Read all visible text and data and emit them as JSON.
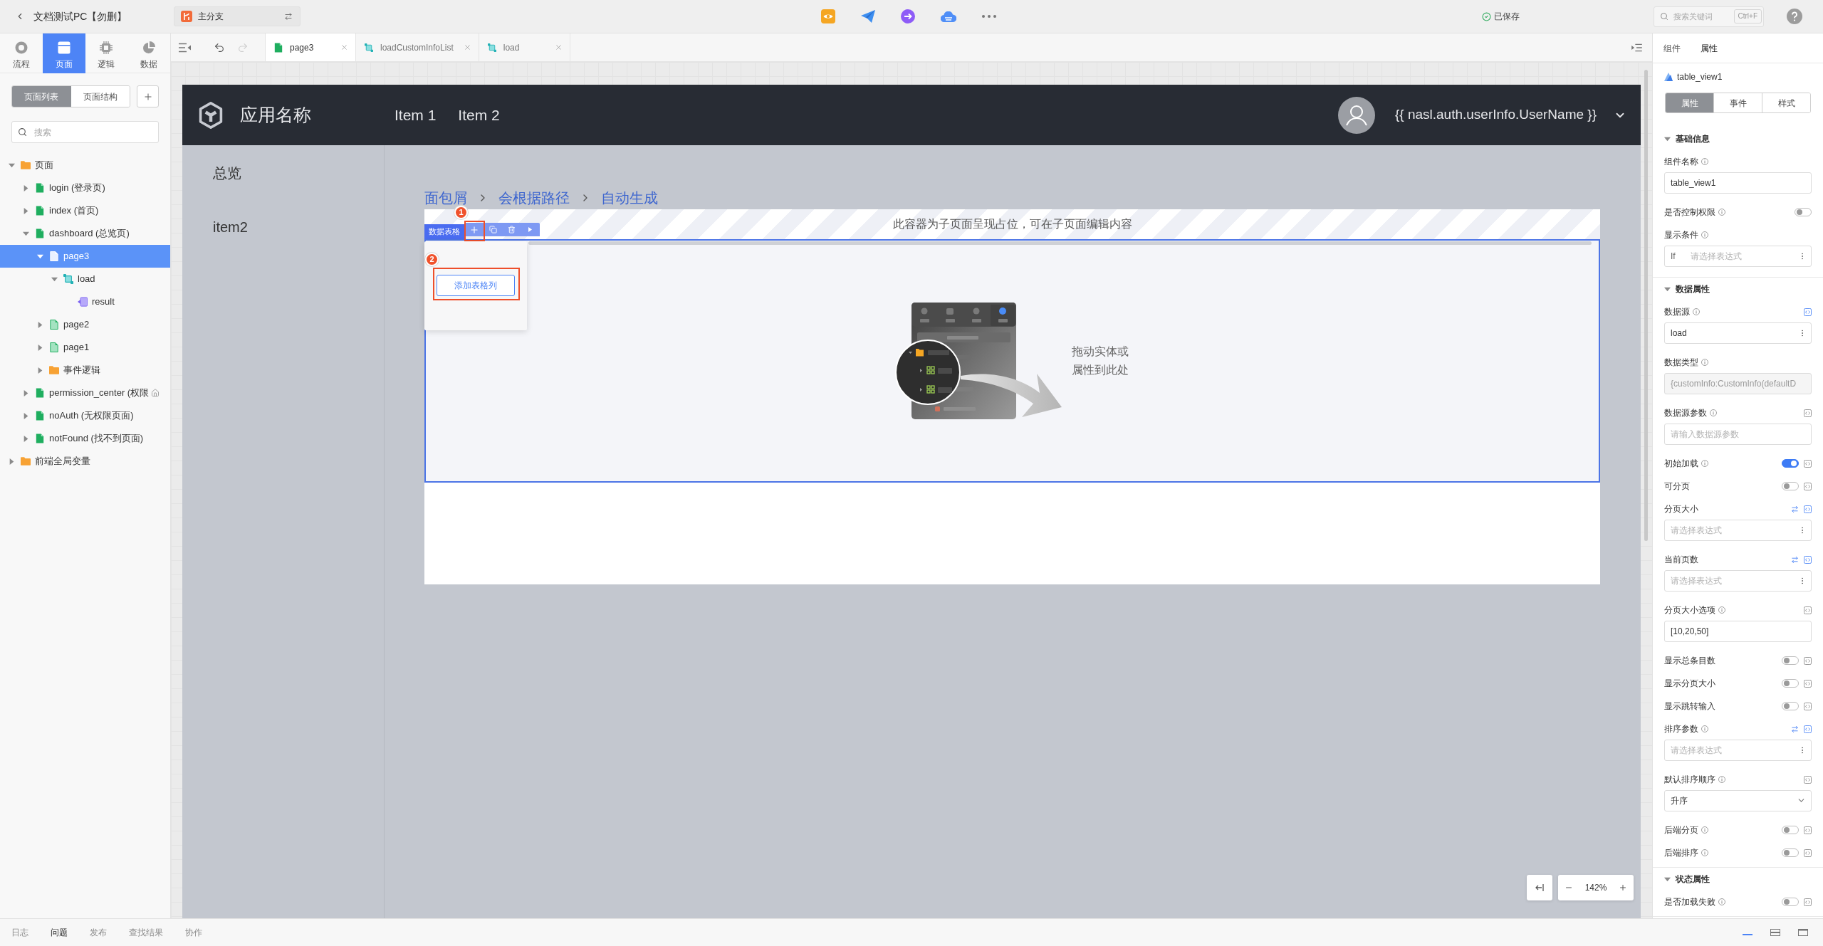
{
  "topbar": {
    "title": "文档测试PC【勿删】",
    "branch": "主分支",
    "save_status": "已保存",
    "search": {
      "placeholder": "搜索关键词",
      "shortcut": "Ctrl+F"
    }
  },
  "left_tabs": [
    {
      "label": "流程",
      "kind": "flow",
      "selected": false
    },
    {
      "label": "页面",
      "kind": "page",
      "selected": true
    },
    {
      "label": "逻辑",
      "kind": "logic",
      "selected": false
    },
    {
      "label": "数据",
      "kind": "data",
      "selected": false
    }
  ],
  "view_switch": [
    {
      "label": "页面列表",
      "selected": true
    },
    {
      "label": "页面结构",
      "selected": false
    }
  ],
  "tree_search": {
    "placeholder": "搜索"
  },
  "tree": [
    {
      "label": "页面",
      "kind": "folder",
      "expanded": true,
      "selected": false,
      "children": [
        {
          "label": "login (登录页)",
          "kind": "page",
          "expanded": false,
          "selected": false,
          "home": false
        },
        {
          "label": "index (首页)",
          "kind": "page",
          "expanded": false,
          "selected": false,
          "home": false
        },
        {
          "label": "dashboard (总览页)",
          "kind": "page",
          "expanded": true,
          "selected": false,
          "home": false,
          "children": [
            {
              "label": "page3",
              "kind": "subpage",
              "expanded": true,
              "selected": true,
              "children": [
                {
                  "label": "load",
                  "kind": "logic",
                  "expanded": true,
                  "selected": false,
                  "children": [
                    {
                      "label": "result",
                      "kind": "variable",
                      "selected": false
                    }
                  ]
                }
              ]
            },
            {
              "label": "page2",
              "kind": "subpage",
              "expanded": false,
              "selected": false
            },
            {
              "label": "page1",
              "kind": "subpage",
              "expanded": false,
              "selected": false
            },
            {
              "label": "事件逻辑",
              "kind": "folder",
              "expanded": false,
              "selected": false
            }
          ]
        },
        {
          "label": "permission_center (权限",
          "kind": "page",
          "expanded": false,
          "selected": false,
          "home": true
        },
        {
          "label": "noAuth (无权限页面)",
          "kind": "page",
          "expanded": false,
          "selected": false,
          "home": false
        },
        {
          "label": "notFound (找不到页面)",
          "kind": "page",
          "expanded": false,
          "selected": false,
          "home": false
        }
      ]
    },
    {
      "label": "前端全局变量",
      "kind": "folder",
      "expanded": false,
      "selected": false
    }
  ],
  "editor": {
    "history": [
      {
        "kind": "undo",
        "disabled": false
      },
      {
        "kind": "redo",
        "disabled": true
      }
    ],
    "tabs": [
      {
        "label": "page3",
        "kind": "page",
        "selected": true
      },
      {
        "label": "loadCustomInfoList",
        "kind": "logic",
        "selected": false
      },
      {
        "label": "load",
        "kind": "logic",
        "selected": false
      }
    ]
  },
  "preview": {
    "app_name": "应用名称",
    "nav": [
      "Item 1",
      "Item 2"
    ],
    "user": "{{ nasl.auth.userInfo.UserName }}",
    "sidebar": [
      "总览",
      "item2"
    ],
    "breadcrumb": [
      "面包屑",
      "会根据路径",
      "自动生成"
    ],
    "placeholder_message": "此容器为子页面呈现占位，可在子页面编辑内容",
    "table": {
      "label": "数据表格",
      "add_column_button": "添加表格列",
      "empty_hint": "拖动实体或属性到此处"
    },
    "steps": [
      "1",
      "2"
    ]
  },
  "zoom": {
    "value": "142%"
  },
  "properties": {
    "tabs": [
      {
        "label": "组件",
        "selected": false
      },
      {
        "label": "属性",
        "selected": true
      }
    ],
    "component_name": "table_view1",
    "sub_tabs": [
      {
        "label": "属性",
        "selected": true
      },
      {
        "label": "事件",
        "selected": false
      },
      {
        "label": "样式",
        "selected": false
      }
    ],
    "sections": [
      {
        "title": "基础信息",
        "expanded": true,
        "fields": [
          {
            "label": "组件名称",
            "info": true,
            "kind": "text",
            "value": "table_view1"
          },
          {
            "label": "是否控制权限",
            "info": true,
            "kind": "switch",
            "on": false
          },
          {
            "label": "显示条件",
            "info": true,
            "kind": "expression",
            "prefix": "If",
            "placeholder": "请选择表达式"
          }
        ]
      },
      {
        "title": "数据属性",
        "expanded": true,
        "fields": [
          {
            "label": "数据源",
            "info": true,
            "kind": "menu_select",
            "value": "load",
            "swap": false,
            "bound": true
          },
          {
            "label": "数据类型",
            "info": true,
            "kind": "readonly",
            "value": "{customInfo:CustomInfo(defaultD",
            "swap": false
          },
          {
            "label": "数据源参数",
            "info": true,
            "kind": "text",
            "placeholder": "请输入数据源参数",
            "swap": false,
            "bound": false
          },
          {
            "label": "初始加载",
            "info": true,
            "kind": "switch",
            "on": true,
            "swap": false,
            "bound": false
          },
          {
            "label": "可分页",
            "info": false,
            "kind": "switch",
            "on": false,
            "swap": false,
            "bound": false
          },
          {
            "label": "分页大小",
            "info": false,
            "kind": "expression",
            "placeholder": "请选择表达式",
            "swap": true,
            "bound": true
          },
          {
            "label": "当前页数",
            "info": false,
            "kind": "expression",
            "placeholder": "请选择表达式",
            "swap": true,
            "bound": true
          },
          {
            "label": "分页大小选项",
            "info": true,
            "kind": "text",
            "value": "[10,20,50]",
            "swap": false,
            "bound": false
          },
          {
            "label": "显示总条目数",
            "info": false,
            "kind": "switch",
            "on": false,
            "swap": false,
            "bound": false
          },
          {
            "label": "显示分页大小",
            "info": false,
            "kind": "switch",
            "on": false,
            "swap": false,
            "bound": false
          },
          {
            "label": "显示跳转输入",
            "info": false,
            "kind": "switch",
            "on": false,
            "swap": false,
            "bound": false
          },
          {
            "label": "排序参数",
            "info": true,
            "kind": "expression",
            "placeholder": "请选择表达式",
            "swap": true,
            "bound": true
          },
          {
            "label": "默认排序顺序",
            "info": true,
            "kind": "dropdown",
            "value": "升序",
            "swap": false,
            "bound": false
          },
          {
            "label": "后端分页",
            "info": true,
            "kind": "switch",
            "on": false,
            "swap": false,
            "bound": false
          },
          {
            "label": "后端排序",
            "info": true,
            "kind": "switch",
            "on": false,
            "swap": false,
            "bound": false
          }
        ]
      },
      {
        "title": "状态属性",
        "expanded": true,
        "fields": [
          {
            "label": "是否加载失败",
            "info": true,
            "kind": "switch",
            "on": false,
            "bound": false
          }
        ]
      }
    ]
  },
  "bottom_bar": {
    "tabs": [
      {
        "label": "日志",
        "selected": false
      },
      {
        "label": "问题",
        "selected": true
      },
      {
        "label": "发布",
        "selected": false
      },
      {
        "label": "查找结果",
        "selected": false
      },
      {
        "label": "协作",
        "selected": false
      }
    ],
    "layouts": [
      {
        "kind": "docked",
        "selected": true
      },
      {
        "kind": "split",
        "selected": false
      },
      {
        "kind": "full",
        "selected": false
      }
    ]
  }
}
